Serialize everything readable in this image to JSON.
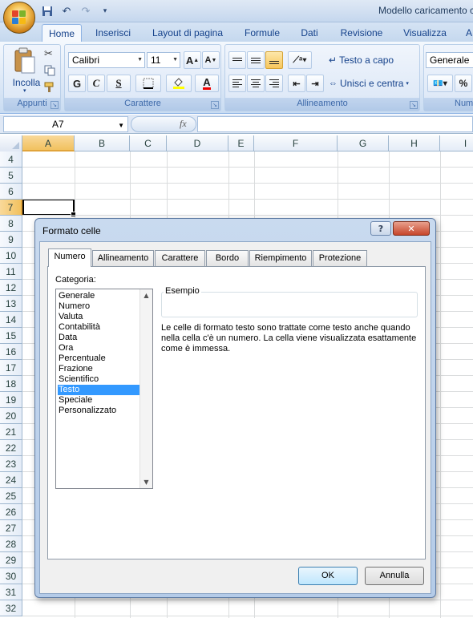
{
  "window": {
    "title": "Modello caricamento c"
  },
  "tabs": [
    "Home",
    "Inserisci",
    "Layout di pagina",
    "Formule",
    "Dati",
    "Revisione",
    "Visualizza",
    "A"
  ],
  "ribbon": {
    "clipboard": {
      "label": "Appunti",
      "paste_label": "Incolla"
    },
    "font": {
      "label": "Carattere",
      "font_name": "Calibri",
      "font_size": "11",
      "bold": "G",
      "italic": "C",
      "underline": "S"
    },
    "alignment": {
      "label": "Allineamento",
      "wrap_text": "Testo a capo",
      "merge_center": "Unisci e centra"
    },
    "number": {
      "label": "Num",
      "format": "Generale",
      "percent": "%"
    }
  },
  "formula_bar": {
    "name_box": "A7",
    "fx": "fx",
    "value": ""
  },
  "sheet": {
    "columns": [
      "A",
      "B",
      "C",
      "D",
      "E",
      "F",
      "G",
      "H",
      "I"
    ],
    "rows": [
      "4",
      "5",
      "6",
      "7",
      "8",
      "9",
      "10",
      "11",
      "12",
      "13",
      "14",
      "15",
      "16",
      "17",
      "18",
      "19",
      "20",
      "21",
      "22",
      "23",
      "24",
      "25",
      "26",
      "27",
      "28",
      "29",
      "30",
      "31",
      "32"
    ],
    "selected_cell": "A7"
  },
  "dialog": {
    "title": "Formato celle",
    "help": "?",
    "close": "✕",
    "tabs": [
      "Numero",
      "Allineamento",
      "Carattere",
      "Bordo",
      "Riempimento",
      "Protezione"
    ],
    "active_tab": "Numero",
    "category_label": "Categoria:",
    "categories": [
      "Generale",
      "Numero",
      "Valuta",
      "Contabilità",
      "Data",
      "Ora",
      "Percentuale",
      "Frazione",
      "Scientifico",
      "Testo",
      "Speciale",
      "Personalizzato"
    ],
    "selected_category": "Testo",
    "example_label": "Esempio",
    "description": "Le celle di formato testo sono trattate come testo anche quando nella cella c'è un numero. La cella viene visualizzata esattamente come è immessa.",
    "ok_label": "OK",
    "cancel_label": "Annulla"
  }
}
